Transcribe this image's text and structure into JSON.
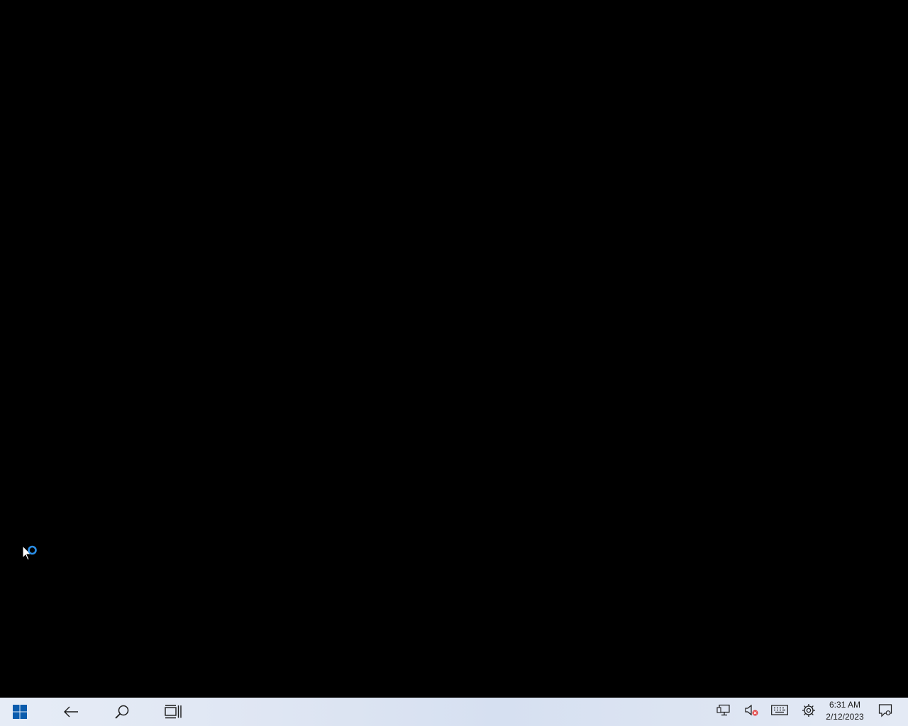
{
  "desktop": {
    "background": "#000000"
  },
  "cursor": {
    "icon": "busy-pointer-icon",
    "spinner_color": "#2a8ee6"
  },
  "taskbar": {
    "buttons": [
      {
        "name": "start",
        "icon": "windows-logo-icon"
      },
      {
        "name": "back",
        "icon": "back-arrow-icon"
      },
      {
        "name": "search",
        "icon": "search-icon"
      },
      {
        "name": "task-view",
        "icon": "task-view-icon"
      }
    ],
    "tray": [
      {
        "name": "network",
        "icon": "network-icon"
      },
      {
        "name": "volume",
        "icon": "volume-muted-icon"
      },
      {
        "name": "touch-keyboard",
        "icon": "keyboard-icon"
      },
      {
        "name": "settings",
        "icon": "gear-icon"
      }
    ],
    "clock": {
      "time": "6:31 AM",
      "date": "2/12/2023"
    },
    "notification_icon": "action-center-icon"
  }
}
